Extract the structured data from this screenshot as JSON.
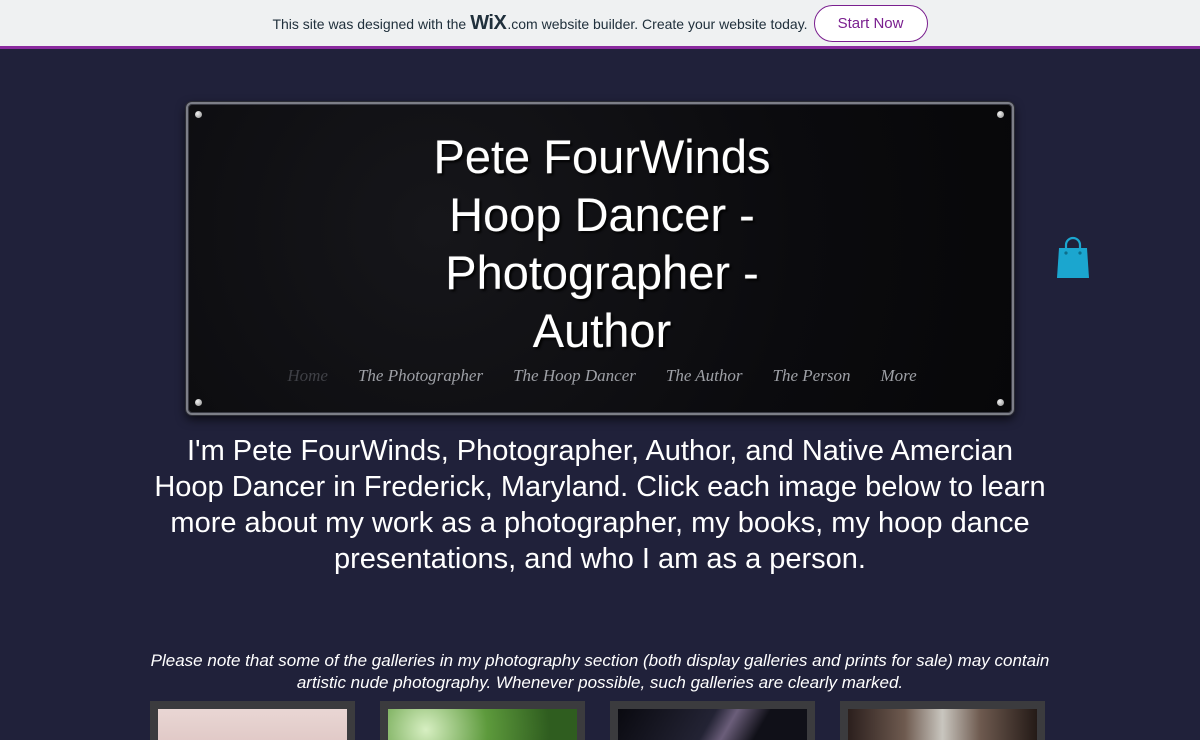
{
  "banner": {
    "text_before": "This site was designed with the",
    "logo": "WiX",
    "dotcom": ".com",
    "text_after": "website builder. Create your website today.",
    "button_label": "Start Now",
    "accent_color": "#7a1f8f"
  },
  "header": {
    "title_lines": [
      "Pete FourWinds",
      "Hoop Dancer -",
      "Photographer -",
      "Author"
    ],
    "nav": [
      "Home",
      "The Photographer",
      "The Hoop Dancer",
      "The Author",
      "The Person",
      "More"
    ],
    "active_nav": "Home"
  },
  "cart": {
    "icon": "shopping-bag-icon",
    "color": "#1ba6cf"
  },
  "intro": "I'm Pete FourWinds, Photographer, Author, and Native Amercian Hoop Dancer in Frederick, Maryland. Click each image below to learn more about my work as a photographer, my books, my hoop dance presentations, and who I am as a person.",
  "note": "Please note that some of the galleries in my photography section (both display galleries and prints for sale) may contain artistic nude photography. Whenever possible, such galleries are clearly marked.",
  "colors": {
    "background": "#20213a",
    "banner_bg": "#eff1f2",
    "banner_strip": "#8a2a9f"
  }
}
